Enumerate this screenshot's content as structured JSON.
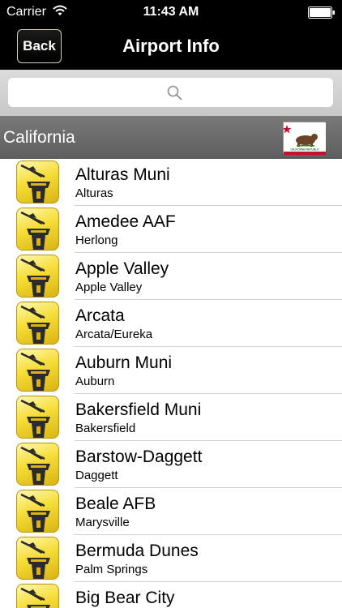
{
  "status_bar": {
    "carrier": "Carrier",
    "time": "11:43 AM",
    "wifi_icon": "wifi-icon",
    "battery_icon": "battery-icon"
  },
  "nav": {
    "back_label": "Back",
    "title": "Airport Info"
  },
  "search": {
    "placeholder": "",
    "icon": "search-icon"
  },
  "section": {
    "title": "California",
    "flag_icon": "california-flag-icon",
    "flag_text": "CALIFORNIA REPUBLIC"
  },
  "airports": [
    {
      "name": "Alturas Muni",
      "city": "Alturas"
    },
    {
      "name": "Amedee AAF",
      "city": "Herlong"
    },
    {
      "name": "Apple Valley",
      "city": "Apple Valley"
    },
    {
      "name": "Arcata",
      "city": "Arcata/Eureka"
    },
    {
      "name": "Auburn Muni",
      "city": "Auburn"
    },
    {
      "name": "Bakersfield Muni",
      "city": "Bakersfield"
    },
    {
      "name": "Barstow-Daggett",
      "city": "Daggett"
    },
    {
      "name": "Beale AFB",
      "city": "Marysville"
    },
    {
      "name": "Bermuda Dunes",
      "city": "Palm Springs"
    },
    {
      "name": "Big Bear City",
      "city": ""
    }
  ],
  "colors": {
    "nav_background": "#000000",
    "section_header": "#6b6b6b",
    "icon_yellow": "#f6dd38"
  }
}
